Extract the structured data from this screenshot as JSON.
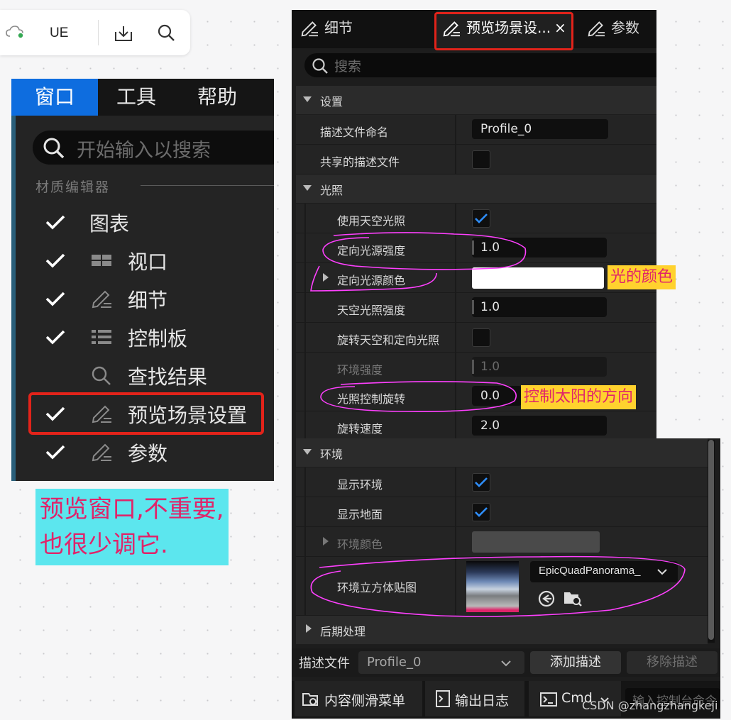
{
  "toolbar": {
    "app_label": "UE",
    "icons": [
      "cloud-sync-icon",
      "download-icon",
      "search-icon"
    ]
  },
  "window_menu": {
    "menubar": [
      "窗口",
      "工具",
      "帮助"
    ],
    "search_placeholder": "开始输入以搜索",
    "section": "材质编辑器",
    "items": [
      {
        "label": "图表",
        "checked": true,
        "icon": ""
      },
      {
        "label": "视口",
        "checked": true,
        "icon": "viewport-icon"
      },
      {
        "label": "细节",
        "checked": true,
        "icon": "details-icon"
      },
      {
        "label": "控制板",
        "checked": true,
        "icon": "palette-icon"
      },
      {
        "label": "查找结果",
        "checked": false,
        "icon": "search-icon"
      },
      {
        "label": "预览场景设置",
        "checked": true,
        "icon": "details-icon"
      },
      {
        "label": "参数",
        "checked": true,
        "icon": "details-icon"
      }
    ]
  },
  "annotations": {
    "cyan_note_line1": "预览窗口,不重要,",
    "cyan_note_line2": "也很少调它.",
    "light_color_note": "光的颜色",
    "sun_dir_note": "控制太阳的方向"
  },
  "details_panel": {
    "tabs": [
      "细节",
      "预览场景设...",
      "参数"
    ],
    "tab_close": "×",
    "search_placeholder": "搜索",
    "sections": {
      "settings": "设置",
      "lighting": "光照",
      "environment": "环境",
      "postprocess": "后期处理"
    },
    "rows": {
      "profile_name_label": "描述文件命名",
      "profile_name_value": "Profile_0",
      "shared_profile_label": "共享的描述文件",
      "use_skylight_label": "使用天空光照",
      "dir_intensity_label": "定向光源强度",
      "dir_intensity_value": "1.0",
      "dir_color_label": "定向光源颜色",
      "sky_intensity_label": "天空光照强度",
      "sky_intensity_value": "1.0",
      "rotate_label": "旋转天空和定向光照",
      "env_intensity_label": "环境强度",
      "env_intensity_value": "1.0",
      "light_rotation_label": "光照控制旋转",
      "light_rotation_value": "0.0",
      "rotation_speed_label": "旋转速度",
      "rotation_speed_value": "2.0",
      "show_env_label": "显示环境",
      "show_floor_label": "显示地面",
      "env_color_label": "环境颜色",
      "env_cubemap_label": "环境立方体贴图",
      "env_cubemap_value": "EpicQuadPanorama_"
    },
    "footer": {
      "profile_label": "描述文件",
      "profile_value": "Profile_0",
      "add_button": "添加描述",
      "remove_button": "移除描述"
    },
    "statusbar": {
      "content_drawer": "内容侧滑菜单",
      "output_log": "输出日志",
      "cmd": "Cmd",
      "console_placeholder": "输入控制台命令"
    }
  },
  "watermark": "CSDN @zhangzhangkeji",
  "colors": {
    "accent_blue": "#0e6ddf",
    "highlight_red": "#e2231a",
    "annotation_pink": "#e0246a",
    "cyan_bg": "#5ce6ee",
    "yellow_bg": "#ffd22e"
  }
}
